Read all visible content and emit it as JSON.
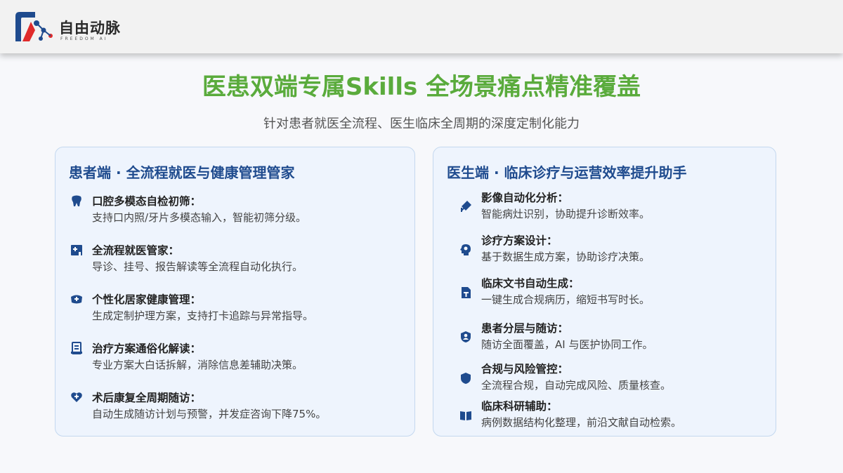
{
  "header": {
    "logo_cn": "自由动脉",
    "logo_en": "FREEDOM AI"
  },
  "headline": "医患双端专属Skills 全场景痛点精准覆盖",
  "subheadline": "针对患者就医全流程、医生临床全周期的深度定制化能力",
  "patient": {
    "title": "患者端 · 全流程就医与健康管理管家",
    "items": [
      {
        "icon": "tooth-icon",
        "title": "口腔多模态自检初筛：",
        "desc": "支持口内照/牙片多模态输入，智能初筛分级。"
      },
      {
        "icon": "hospital-plus-icon",
        "title": "全流程就医管家：",
        "desc": "导诊、挂号、报告解读等全流程自动化执行。"
      },
      {
        "icon": "home-care-icon",
        "title": "个性化居家健康管理：",
        "desc": "生成定制护理方案，支持打卡追踪与异常指导。"
      },
      {
        "icon": "document-list-icon",
        "title": "治疗方案通俗化解读：",
        "desc": "专业方案大白话拆解，消除信息差辅助决策。"
      },
      {
        "icon": "heart-care-icon",
        "title": "术后康复全周期随访：",
        "desc": "自动生成随访计划与预警，并发症咨询下降75%。"
      }
    ]
  },
  "doctor": {
    "title": "医生端 · 临床诊疗与运营效率提升助手",
    "items": [
      {
        "icon": "syringe-icon",
        "title": "影像自动化分析：",
        "desc": "智能病灶识别，协助提升诊断效率。"
      },
      {
        "icon": "brain-icon",
        "title": "诊疗方案设计：",
        "desc": "基于数据生成方案，协助诊疗决策。"
      },
      {
        "icon": "text-file-icon",
        "title": "临床文书自动生成：",
        "desc": "一键生成合规病历，缩短书写时长。"
      },
      {
        "icon": "user-shield-icon",
        "title": "患者分层与随访：",
        "desc": "随访全面覆盖，AI 与医护协同工作。"
      },
      {
        "icon": "shield-icon",
        "title": "合规与风险管控：",
        "desc": "全流程合规，自动完成风险、质量核查。"
      },
      {
        "icon": "book-icon",
        "title": "临床科研辅助：",
        "desc": "病例数据结构化整理，前沿文献自动检索。"
      }
    ]
  },
  "colors": {
    "headline": "#5aab3c",
    "card_title": "#1f4b8e",
    "icon": "#1f4b8e"
  }
}
